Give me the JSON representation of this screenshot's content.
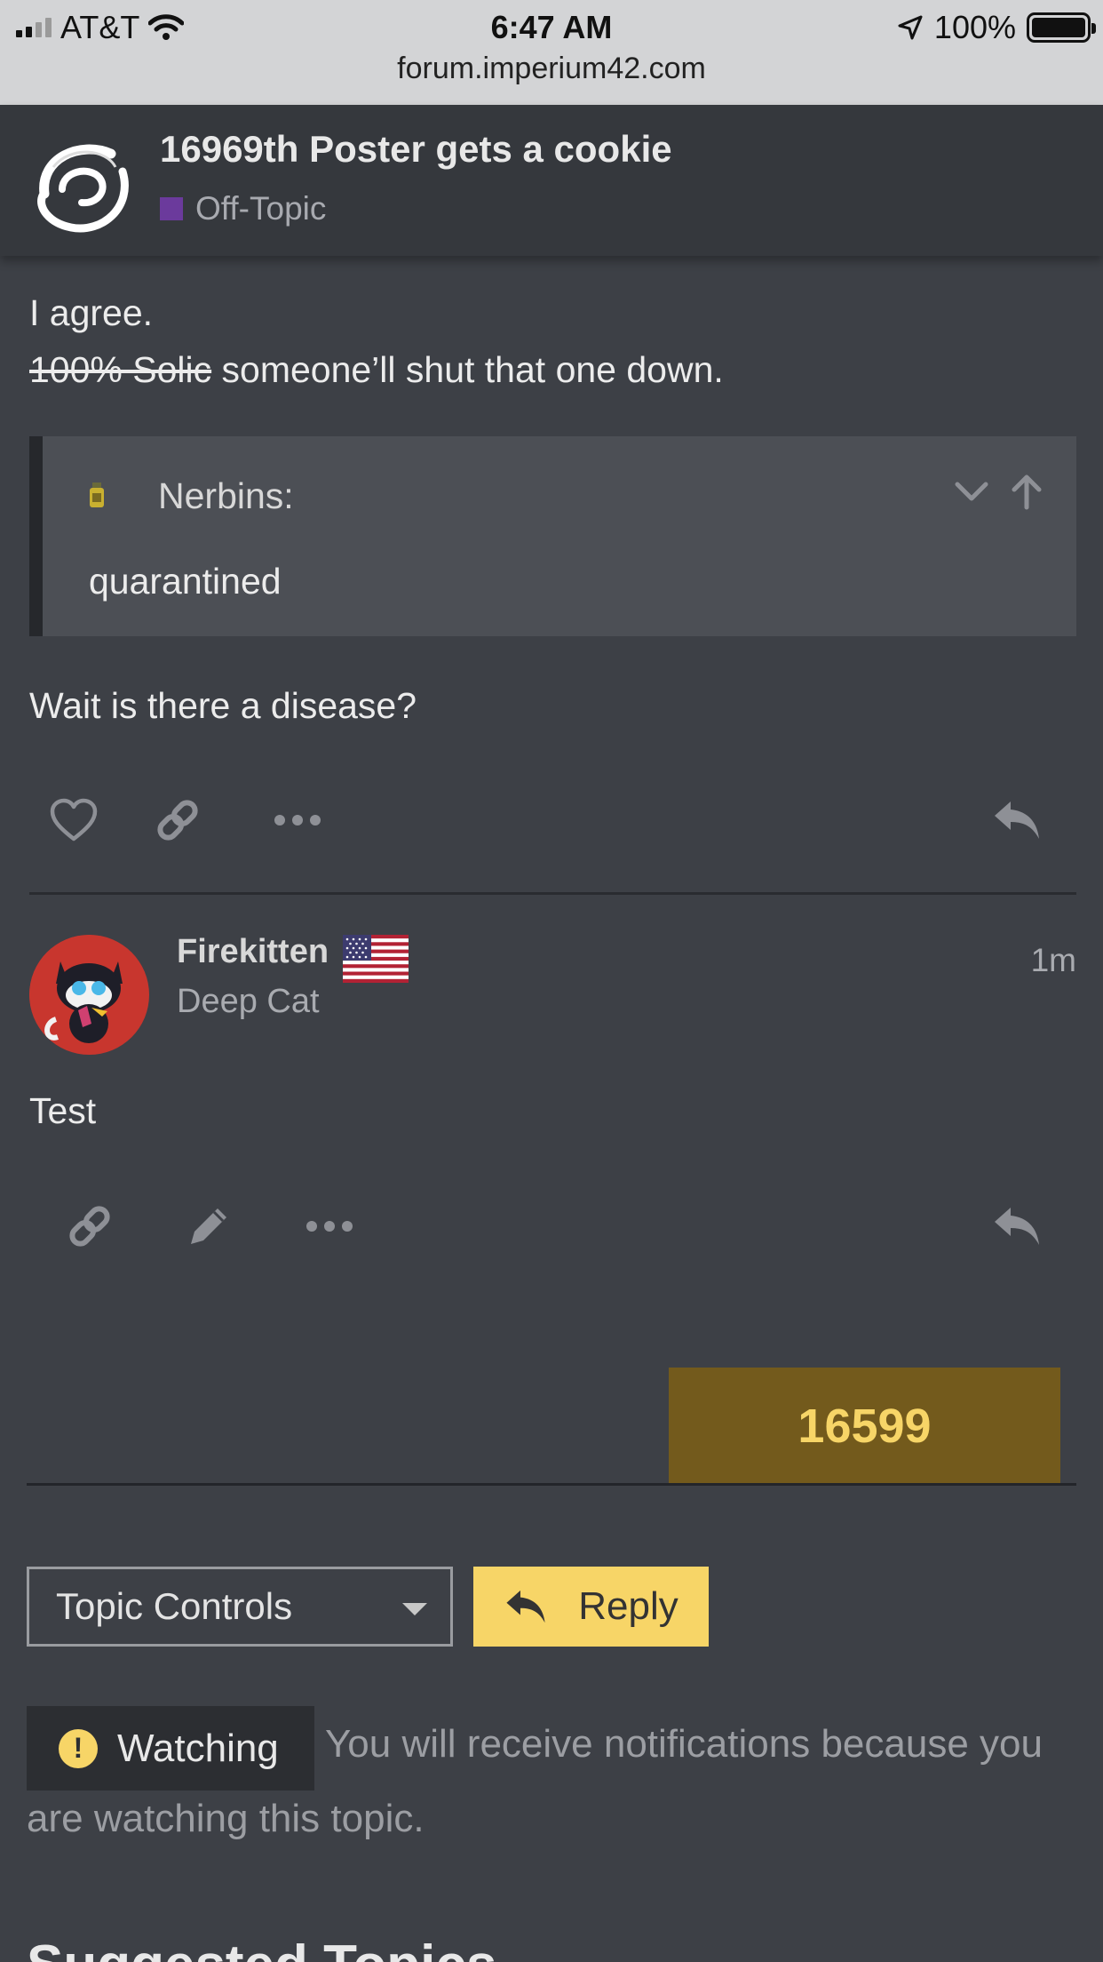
{
  "status_bar": {
    "carrier": "AT&T",
    "time": "6:47 AM",
    "battery": "100%",
    "url": "forum.imperium42.com"
  },
  "topic": {
    "title": "16969th Poster gets a cookie",
    "category": "Off-Topic",
    "category_color": "#6b3a9c"
  },
  "post1": {
    "line1": "I agree.",
    "line2_struck": "100% Solic",
    "line2_rest": " someone’ll shut that one down.",
    "quote": {
      "author": "Nerbins:",
      "text": "quarantined"
    },
    "line3": "Wait is there a disease?"
  },
  "post2": {
    "username": "Firekitten",
    "user_title": "Deep Cat",
    "time": "1m",
    "body": "Test"
  },
  "counter": {
    "value": "16599"
  },
  "controls": {
    "topic_controls_label": "Topic Controls",
    "reply_label": "Reply"
  },
  "notification": {
    "level": "Watching",
    "desc_line1": "You will receive notifications because you",
    "desc_line2": "are watching this topic."
  },
  "suggested": {
    "heading": "Suggested Topics"
  },
  "colors": {
    "accent": "#f7d567",
    "background": "#3d4046",
    "counter_bg": "#735a1c"
  }
}
